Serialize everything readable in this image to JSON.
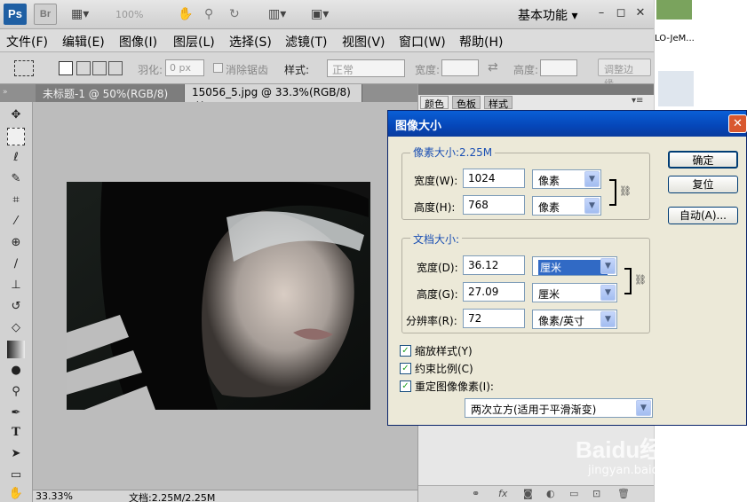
{
  "appbar": {
    "ps_logo": "Ps",
    "br_logo": "Br",
    "zoom": "100%",
    "workspace": "基本功能",
    "min": "–",
    "restore": "◻",
    "close": "✕"
  },
  "menu": [
    "文件(F)",
    "编辑(E)",
    "图像(I)",
    "图层(L)",
    "选择(S)",
    "滤镜(T)",
    "视图(V)",
    "窗口(W)",
    "帮助(H)"
  ],
  "options": {
    "feather_label": "羽化:",
    "feather_value": "0 px",
    "antialias_label": "消除锯齿",
    "style_label": "样式:",
    "style_value": "正常",
    "width_label": "宽度:",
    "height_label": "高度:",
    "refine_edge": "调整边缘..."
  },
  "tabs": [
    {
      "label": "未标题-1 @ 50%(RGB/8)",
      "close": "✕"
    },
    {
      "label": "15056_5.jpg @ 33.3%(RGB/8)",
      "close": "✕"
    }
  ],
  "panel_tabs": [
    "颜色",
    "色板",
    "样式"
  ],
  "status": {
    "zoom": "33.33%",
    "doc": "文档:2.25M/2.25M"
  },
  "strip_text": "LO-JeM...",
  "watermark": {
    "brand": "Baidu经验",
    "url": "jingyan.baidu.com"
  },
  "dialog": {
    "title": "图像大小",
    "close": "✕",
    "pixel_group": "像素大小:2.25M",
    "pixel_width_label": "宽度(W):",
    "pixel_width_value": "1024",
    "pixel_width_unit": "像素",
    "pixel_height_label": "高度(H):",
    "pixel_height_value": "768",
    "pixel_height_unit": "像素",
    "doc_group": "文档大小:",
    "doc_width_label": "宽度(D):",
    "doc_width_value": "36.12",
    "doc_width_unit": "厘米",
    "doc_height_label": "高度(G):",
    "doc_height_value": "27.09",
    "doc_height_unit": "厘米",
    "resolution_label": "分辨率(R):",
    "resolution_value": "72",
    "resolution_unit": "像素/英寸",
    "scale_styles": "缩放样式(Y)",
    "constrain": "约束比例(C)",
    "resample": "重定图像像素(I):",
    "resample_method": "两次立方(适用于平滑渐变)",
    "ok": "确定",
    "reset": "复位",
    "auto": "自动(A)...",
    "checked": "✓"
  }
}
